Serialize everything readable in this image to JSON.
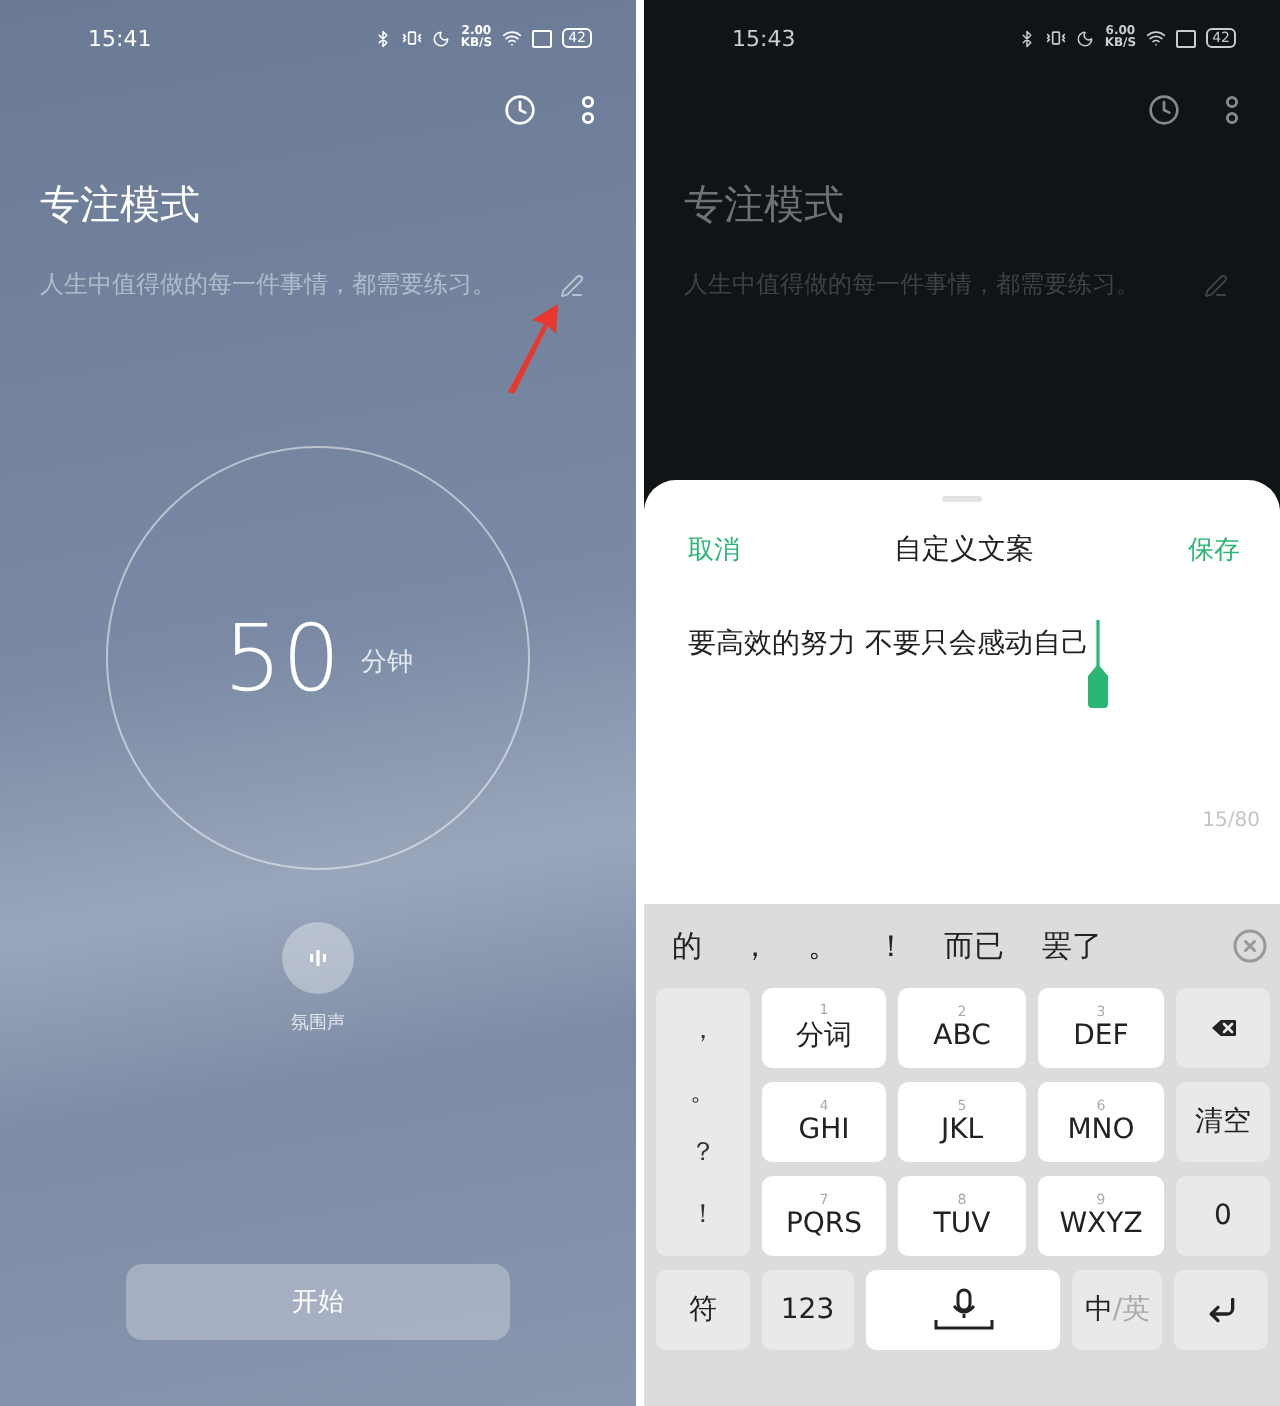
{
  "screens": [
    {
      "kind": "focus",
      "status_bar": {
        "time": "15:41",
        "speed": "2.00",
        "speed_unit": "KB/S",
        "battery": "42"
      },
      "title": "专注模式",
      "motto": "人生中值得做的每一件事情，都需要练习。",
      "timer": {
        "value": "50",
        "unit": "分钟"
      },
      "ambient_label": "氛围声",
      "start_button": "开始"
    },
    {
      "kind": "editor",
      "status_bar": {
        "time": "15:43",
        "speed": "6.00",
        "speed_unit": "KB/S",
        "battery": "42"
      },
      "title": "专注模式",
      "motto": "人生中值得做的每一件事情，都需要练习。",
      "dialog": {
        "cancel": "取消",
        "title": "自定义文案",
        "save": "保存",
        "text": "要高效的努力 不要只会感动自己",
        "counter": "15/80"
      },
      "keyboard": {
        "candidates": [
          "的",
          "，",
          "。",
          "！",
          "而已",
          "罢了"
        ],
        "symbols": [
          "，",
          "。",
          "？",
          "！"
        ],
        "rows": [
          [
            {
              "kind": "letter",
              "digit": "1",
              "label": "分词"
            },
            {
              "kind": "letter",
              "digit": "2",
              "label": "ABC"
            },
            {
              "kind": "letter",
              "digit": "3",
              "label": "DEF"
            },
            {
              "kind": "delete"
            }
          ],
          [
            {
              "kind": "letter",
              "digit": "4",
              "label": "GHI"
            },
            {
              "kind": "letter",
              "digit": "5",
              "label": "JKL"
            },
            {
              "kind": "letter",
              "digit": "6",
              "label": "MNO"
            },
            {
              "kind": "action",
              "label": "清空"
            }
          ],
          [
            {
              "kind": "letter",
              "digit": "7",
              "label": "PQRS"
            },
            {
              "kind": "letter",
              "digit": "8",
              "label": "TUV"
            },
            {
              "kind": "letter",
              "digit": "9",
              "label": "WXYZ"
            },
            {
              "kind": "action",
              "label": "0"
            }
          ]
        ],
        "bottom": {
          "symbol_key": "符",
          "number_key": "123",
          "lang_active": "中",
          "lang_inactive": "/英"
        }
      }
    }
  ]
}
